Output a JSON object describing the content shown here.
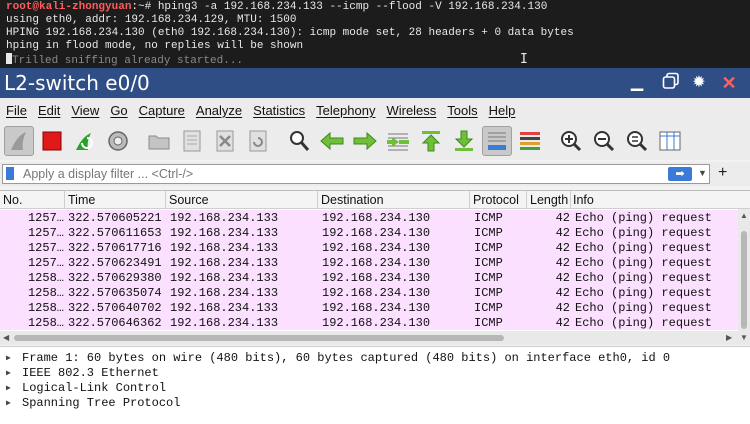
{
  "terminal": {
    "user_host": "root@kali-zhongyuan",
    "prompt_tail": ":~# ",
    "command": "hping3 -a 192.168.234.133 --icmp --flood -V 192.168.234.130",
    "line2": "using eth0, addr: 192.168.234.129, MTU: 1500",
    "line3": "HPING 192.168.234.130 (eth0 192.168.234.130): icmp mode set, 28 headers + 0 data bytes",
    "line4": "hping in flood mode, no replies will be shown",
    "line5": "Trilled sniffing already started..."
  },
  "window": {
    "title": "L2-switch e0/0"
  },
  "menu": [
    "File",
    "Edit",
    "View",
    "Go",
    "Capture",
    "Analyze",
    "Statistics",
    "Telephony",
    "Wireless",
    "Tools",
    "Help"
  ],
  "filter": {
    "placeholder": "Apply a display filter ... <Ctrl-/>"
  },
  "columns": {
    "no": "No.",
    "time": "Time",
    "source": "Source",
    "destination": "Destination",
    "protocol": "Protocol",
    "length": "Length",
    "info": "Info"
  },
  "packets": [
    {
      "no": "1257…",
      "time": "322.570605221",
      "src": "192.168.234.133",
      "dst": "192.168.234.130",
      "proto": "ICMP",
      "len": "42",
      "info": "Echo (ping) request"
    },
    {
      "no": "1257…",
      "time": "322.570611653",
      "src": "192.168.234.133",
      "dst": "192.168.234.130",
      "proto": "ICMP",
      "len": "42",
      "info": "Echo (ping) request"
    },
    {
      "no": "1257…",
      "time": "322.570617716",
      "src": "192.168.234.133",
      "dst": "192.168.234.130",
      "proto": "ICMP",
      "len": "42",
      "info": "Echo (ping) request"
    },
    {
      "no": "1257…",
      "time": "322.570623491",
      "src": "192.168.234.133",
      "dst": "192.168.234.130",
      "proto": "ICMP",
      "len": "42",
      "info": "Echo (ping) request"
    },
    {
      "no": "1258…",
      "time": "322.570629380",
      "src": "192.168.234.133",
      "dst": "192.168.234.130",
      "proto": "ICMP",
      "len": "42",
      "info": "Echo (ping) request"
    },
    {
      "no": "1258…",
      "time": "322.570635074",
      "src": "192.168.234.133",
      "dst": "192.168.234.130",
      "proto": "ICMP",
      "len": "42",
      "info": "Echo (ping) request"
    },
    {
      "no": "1258…",
      "time": "322.570640702",
      "src": "192.168.234.133",
      "dst": "192.168.234.130",
      "proto": "ICMP",
      "len": "42",
      "info": "Echo (ping) request"
    },
    {
      "no": "1258…",
      "time": "322.570646362",
      "src": "192.168.234.133",
      "dst": "192.168.234.130",
      "proto": "ICMP",
      "len": "42",
      "info": "Echo (ping) request"
    }
  ],
  "details": [
    "Frame 1: 60 bytes on wire (480 bits), 60 bytes captured (480 bits) on interface eth0, id 0",
    "IEEE 802.3 Ethernet",
    "Logical-Link Control",
    "Spanning Tree Protocol"
  ],
  "colors": {
    "titlebar": "#2f4e85",
    "row_bg": "#fce0ff",
    "accent_blue": "#3a7ad9",
    "terminal_bg": "#1c1c1c"
  },
  "toolbar_icons": [
    "shark-fin-start-icon",
    "stop-capture-icon",
    "restart-capture-icon",
    "capture-options-icon",
    "open-file-icon",
    "save-file-icon",
    "close-file-icon",
    "reload-file-icon",
    "find-packet-icon",
    "go-back-icon",
    "go-forward-icon",
    "go-to-packet-icon",
    "go-first-icon",
    "go-last-icon",
    "auto-scroll-icon",
    "colorize-icon",
    "zoom-in-icon",
    "zoom-out-icon",
    "normal-size-icon",
    "resize-columns-icon"
  ]
}
